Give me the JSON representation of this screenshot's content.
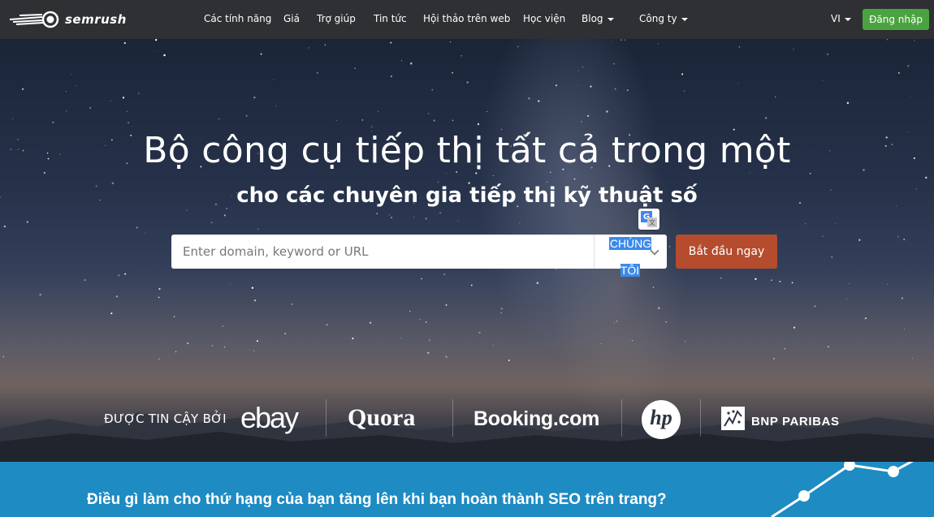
{
  "brand": {
    "name": "semrush"
  },
  "nav": {
    "items": [
      {
        "label": "Các tính năng",
        "has_caret": false
      },
      {
        "label": "Giá",
        "has_caret": false
      },
      {
        "label": "Trợ giúp",
        "has_caret": false
      },
      {
        "label": "Tin tức",
        "has_caret": false
      },
      {
        "label": "Hội thảo trên web",
        "has_caret": false
      },
      {
        "label": "Học viện",
        "has_caret": false
      },
      {
        "label": "Blog",
        "has_caret": true
      },
      {
        "label": "Công ty",
        "has_caret": true
      }
    ],
    "language": "VI",
    "login_label": "Đăng nhập"
  },
  "hero": {
    "headline": "Bộ công cụ tiếp thị tất cả trong một",
    "subheadline": "cho các chuyên gia tiếp thị kỹ thuật số",
    "search": {
      "placeholder": "Enter domain, keyword or URL",
      "value": "",
      "database_selected": "CHÚNG TÔI"
    },
    "start_button": "Bắt đầu ngay",
    "translate_icon": "google-translate-icon"
  },
  "trusted_by": {
    "label": "ĐƯỢC TIN CẬY BỞI",
    "brands": [
      "ebay",
      "Quora",
      "Booking.com",
      "hp",
      "BNP PARIBAS"
    ]
  },
  "promo": {
    "text": "Điều gì làm cho thứ hạng của bạn tăng lên khi bạn hoàn thành SEO trên trang?"
  },
  "colors": {
    "nav_bg": "#2e3033",
    "login_green": "#4aa340",
    "start_orange": "#b54c2e",
    "band_blue": "#1e8bc3",
    "selection_blue": "#3c8ae8"
  }
}
